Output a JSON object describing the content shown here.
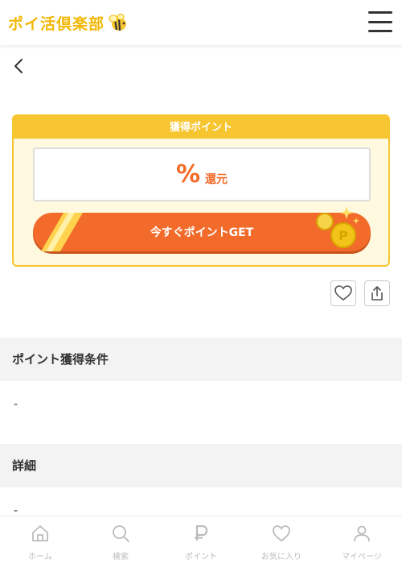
{
  "header": {
    "logo_text": "ポイ活倶楽部",
    "logo_icon": "bee-icon",
    "menu_icon": "hamburger-menu-icon"
  },
  "nav": {
    "back_icon": "chevron-left-icon"
  },
  "points": {
    "header": "獲得ポイント",
    "rate_symbol": "%",
    "rate_unit": "還元",
    "get_button": "今すぐポイントGET",
    "coin_icon": "coins-icon"
  },
  "actions": {
    "favorite_icon": "heart-icon",
    "share_icon": "share-icon"
  },
  "sections": {
    "conditions_title": "ポイント獲得条件",
    "conditions_body": "-",
    "details_title": "詳細",
    "details_body": "-"
  },
  "bottom_nav": {
    "items": [
      {
        "label": "ホーム",
        "icon": "home-icon"
      },
      {
        "label": "検索",
        "icon": "search-icon"
      },
      {
        "label": "ポイント",
        "icon": "point-icon"
      },
      {
        "label": "お気に入り",
        "icon": "heart-icon"
      },
      {
        "label": "マイページ",
        "icon": "user-icon"
      }
    ]
  },
  "colors": {
    "accent_orange": "#f26b2a",
    "accent_yellow": "#f7c530",
    "card_bg": "#fff9e0",
    "nav_gray": "#bbbbbb"
  }
}
